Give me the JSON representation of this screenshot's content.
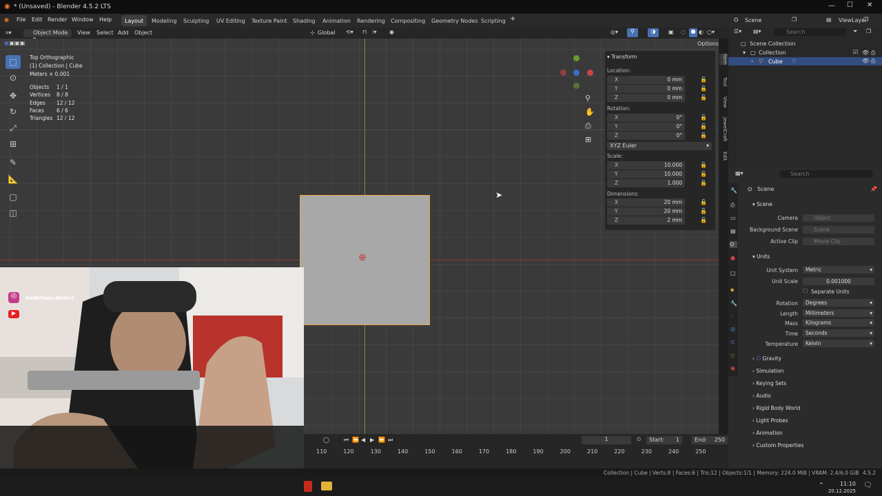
{
  "window": {
    "title": "* (Unsaved) - Blender 4.5.2 LTS",
    "workspace_right": "ViewLayer",
    "scene_field": "Scene"
  },
  "menu": {
    "file": "File",
    "edit": "Edit",
    "render": "Render",
    "window": "Window",
    "help": "Help"
  },
  "workspaces": [
    "Layout",
    "Modeling",
    "Sculpting",
    "UV Editing",
    "Texture Paint",
    "Shading",
    "Animation",
    "Rendering",
    "Compositing",
    "Geometry Nodes",
    "Scripting"
  ],
  "viewport_header": {
    "mode": "Object Mode",
    "view": "View",
    "select": "Select",
    "add": "Add",
    "object": "Object",
    "orientation": "Global",
    "options": "Options"
  },
  "overlay": {
    "view_name": "Top Orthographic",
    "collection": "(1) Collection | Cube",
    "units": "Meters × 0.001",
    "stats": [
      {
        "label": "Objects",
        "value": "1 / 1"
      },
      {
        "label": "Vertices",
        "value": "8 / 8"
      },
      {
        "label": "Edges",
        "value": "12 / 12"
      },
      {
        "label": "Faces",
        "value": "6 / 6"
      },
      {
        "label": "Triangles",
        "value": "12 / 12"
      }
    ]
  },
  "transform": {
    "header": "Transform",
    "location_label": "Location:",
    "location": [
      {
        "axis": "X",
        "value": "0 mm"
      },
      {
        "axis": "Y",
        "value": "0 mm"
      },
      {
        "axis": "Z",
        "value": "0 mm"
      }
    ],
    "rotation_label": "Rotation:",
    "rotation": [
      {
        "axis": "X",
        "value": "0°"
      },
      {
        "axis": "Y",
        "value": "0°"
      },
      {
        "axis": "Z",
        "value": "0°"
      }
    ],
    "rotation_mode": "XYZ Euler",
    "scale_label": "Scale:",
    "scale": [
      {
        "axis": "X",
        "value": "10.000"
      },
      {
        "axis": "Y",
        "value": "10.000"
      },
      {
        "axis": "Z",
        "value": "1.000"
      }
    ],
    "dimensions_label": "Dimensions:",
    "dimensions": [
      {
        "axis": "X",
        "value": "20 mm"
      },
      {
        "axis": "Y",
        "value": "20 mm"
      },
      {
        "axis": "Z",
        "value": "2 mm"
      }
    ]
  },
  "sidebar_tabs": [
    "Item",
    "Tool",
    "View",
    "JewelCraft",
    "Edit"
  ],
  "outliner": {
    "search": "Search",
    "scene_collection": "Scene Collection",
    "collection": "Collection",
    "cube": "Cube"
  },
  "properties": {
    "search": "Search",
    "breadcrumb": "Scene",
    "scene_section": "Scene",
    "camera_label": "Camera",
    "camera_placeholder": "Object",
    "background_label": "Background Scene",
    "background_placeholder": "Scene",
    "clip_label": "Active Clip",
    "clip_placeholder": "Movie Clip",
    "units_section": "Units",
    "unit_system_label": "Unit System",
    "unit_system": "Metric",
    "unit_scale_label": "Unit Scale",
    "unit_scale": "0.001000",
    "separate_units": "Separate Units",
    "rotation_label": "Rotation",
    "rotation": "Degrees",
    "length_label": "Length",
    "length": "Millimeters",
    "mass_label": "Mass",
    "mass": "Kilograms",
    "time_label": "Time",
    "time": "Seconds",
    "temperature_label": "Temperature",
    "temperature": "Kelvin",
    "panels": [
      "Gravity",
      "Simulation",
      "Keying Sets",
      "Audio",
      "Rigid Body World",
      "Light Probes",
      "Animation",
      "Custom Properties"
    ]
  },
  "timeline": {
    "current_frame": "1",
    "start_label": "Start",
    "start": "1",
    "end_label": "End",
    "end": "250",
    "ticks": [
      "110",
      "120",
      "130",
      "140",
      "150",
      "160",
      "170",
      "180",
      "190",
      "200",
      "210",
      "220",
      "230",
      "240",
      "250"
    ]
  },
  "statusbar": {
    "text": "Collection | Cube | Verts:8 | Faces:6 | Tris:12 | Objects:1/1 | Memory: 224.0 MiB | VRAM: 2.4/6.0 GiB",
    "version": "4.5.2"
  },
  "webcam": {
    "handle": "bedirhan.demrr"
  },
  "taskbar": {
    "time": "11:10",
    "date": "20.12.2025"
  },
  "colors": {
    "accent": "#4772b3",
    "selection": "#e8a33d",
    "x_axis": "#8a3a3a",
    "y_axis": "#6a9a2a"
  }
}
